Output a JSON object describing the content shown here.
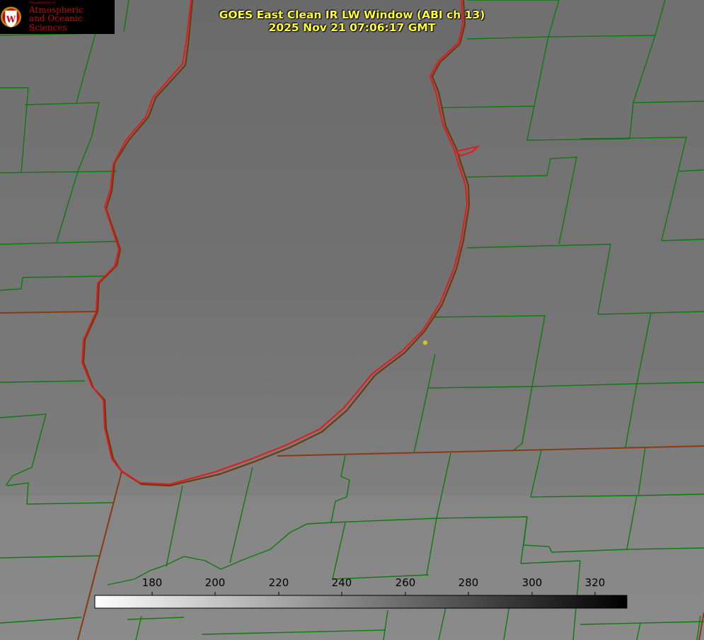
{
  "title": {
    "line1": "GOES East Clean IR LW Window (ABI ch 13)",
    "line2": "2025 Nov 21 07:06:17 GMT"
  },
  "logo": {
    "dept_text": "Department of",
    "line1": "Atmospheric",
    "line2": "and Oceanic Sciences",
    "seal_letter": "W",
    "color": "#c5050c"
  },
  "colorbar": {
    "ticks": [
      "180",
      "200",
      "220",
      "240",
      "260",
      "280",
      "300",
      "320"
    ],
    "tick_values": [
      180,
      200,
      220,
      240,
      260,
      280,
      300,
      320
    ],
    "range": [
      163,
      330
    ],
    "colormap": [
      "#ffffff",
      "#000000"
    ]
  },
  "colors": {
    "county_lines": "#0c7a0c",
    "coastline": "#e41a1a",
    "state_lines": "#8a3a10",
    "marker": "#d4c21e",
    "title": "#ffff33"
  },
  "markers": [
    {
      "name": "yellow-dot"
    }
  ]
}
